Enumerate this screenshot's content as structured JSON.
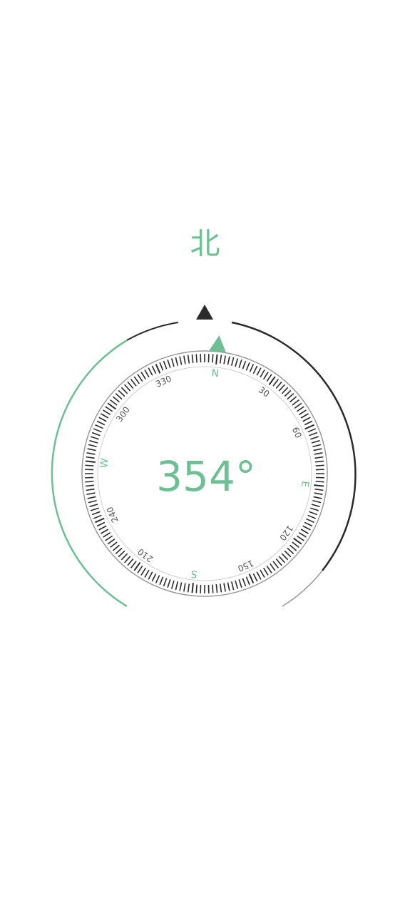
{
  "direction": "北",
  "heading": {
    "value": 354,
    "display": "354°"
  },
  "dial": {
    "cardinals": [
      {
        "deg": 0,
        "label": "N"
      },
      {
        "deg": 90,
        "label": "E"
      },
      {
        "deg": 180,
        "label": "S"
      },
      {
        "deg": 270,
        "label": "W"
      }
    ],
    "degree_labels": [
      {
        "deg": 30,
        "label": "30"
      },
      {
        "deg": 60,
        "label": "60"
      },
      {
        "deg": 120,
        "label": "120"
      },
      {
        "deg": 150,
        "label": "150"
      },
      {
        "deg": 210,
        "label": "210"
      },
      {
        "deg": 240,
        "label": "240"
      },
      {
        "deg": 300,
        "label": "300"
      },
      {
        "deg": 330,
        "label": "330"
      }
    ]
  },
  "colors": {
    "accent": "#6fbf94",
    "dark": "#2b2b2b",
    "ring_grey": "#9a9a9a"
  },
  "icons": {
    "fixed_pointer": "triangle-up-icon",
    "north_marker": "triangle-up-icon"
  }
}
